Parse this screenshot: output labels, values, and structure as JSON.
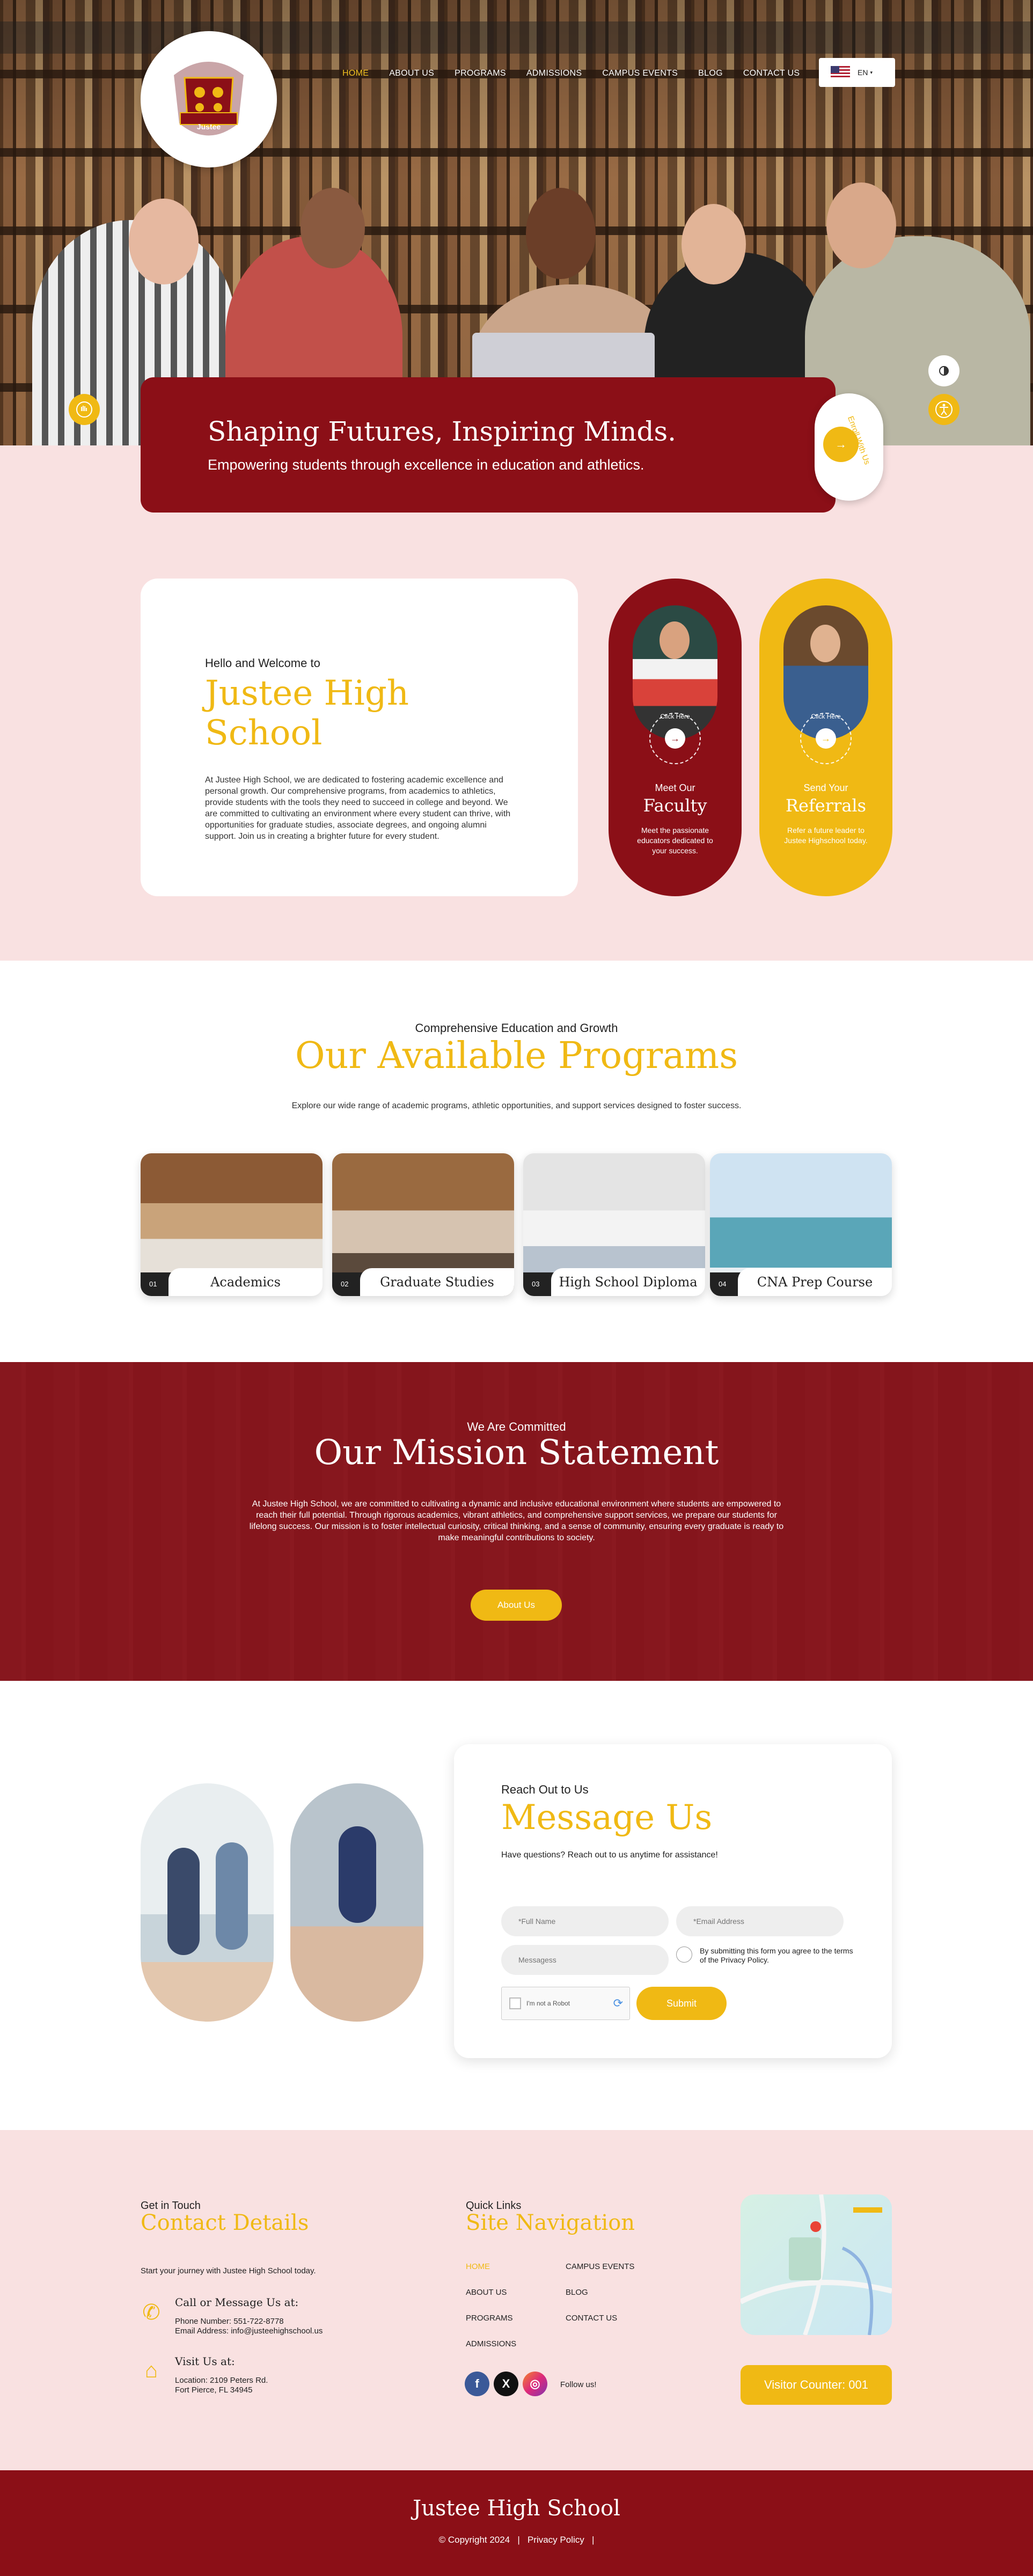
{
  "nav": {
    "items": [
      "HOME",
      "ABOUT US",
      "PROGRAMS",
      "ADMISSIONS",
      "CAMPUS EVENTS",
      "BLOG",
      "CONTACT US"
    ],
    "active_index": 0,
    "language": "EN"
  },
  "logo": {
    "text": "Justee",
    "subtext": "HIGH SCHOOL"
  },
  "hero": {
    "title": "Shaping Futures, Inspiring Minds.",
    "subtitle": "Empowering students through excellence in education and athletics.",
    "enroll_text": "Enroll With Us"
  },
  "welcome": {
    "kicker": "Hello and Welcome to",
    "title": "Justee High School",
    "body": "At Justee High School, we are dedicated to fostering academic excellence and personal growth. Our comprehensive programs, from academics to athletics, provide students with the tools they need to succeed in college and beyond. We are committed to cultivating an environment where every student can thrive, with opportunities for graduate studies, associate degrees, and ongoing alumni support. Join us in creating a brighter future for every student."
  },
  "faculty_pill": {
    "click_text": "Click Here",
    "sub": "Meet Our",
    "title": "Faculty",
    "desc": "Meet the passionate educators dedicated to your success."
  },
  "referral_pill": {
    "click_text": "Click Here",
    "sub": "Send Your",
    "title": "Referrals",
    "desc": "Refer a future leader to Justee Highschool today."
  },
  "programs": {
    "kicker": "Comprehensive Education and Growth",
    "title": "Our Available Programs",
    "intro": "Explore our wide range of academic programs, athletic opportunities, and support services designed to foster success.",
    "items": [
      {
        "num": "01",
        "label": "Academics"
      },
      {
        "num": "02",
        "label": "Graduate Studies"
      },
      {
        "num": "03",
        "label": "High School Diploma"
      },
      {
        "num": "04",
        "label": "CNA Prep Course"
      }
    ]
  },
  "mission": {
    "kicker": "We Are Committed",
    "title": "Our Mission Statement",
    "body": "At Justee High School, we are committed to cultivating a dynamic and inclusive educational environment where students are empowered to reach their full potential. Through rigorous academics, vibrant athletics, and comprehensive support services, we prepare our students for lifelong success. Our mission is to foster intellectual curiosity, critical thinking, and a sense of community, ensuring every graduate is ready to make meaningful contributions to society.",
    "button": "About Us"
  },
  "message": {
    "kicker": "Reach Out to Us",
    "title": "Message Us",
    "intro": "Have questions? Reach out to us anytime for assistance!",
    "full_name_placeholder": "*Full Name",
    "email_placeholder": "*Email Address",
    "message_placeholder": "Messagess",
    "consent_prefix": "By submitting this form you agree to the terms of the ",
    "consent_link": "Privacy Policy.",
    "captcha": "I'm not a Robot",
    "submit": "Submit"
  },
  "footer": {
    "contact_kicker": "Get in Touch",
    "contact_title": "Contact Details",
    "contact_intro": "Start your journey with Justee High School today.",
    "call_title": "Call or Message Us at:",
    "phone": "Phone Number: 551-722-8778",
    "email": "Email Address: info@justeehighschool.us",
    "visit_title": "Visit Us at:",
    "location_line1": "Location: 2109 Peters Rd.",
    "location_line2": "Fort Pierce, FL 34945",
    "links_kicker": "Quick Links",
    "links_title": "Site Navigation",
    "links": [
      "HOME",
      "CAMPUS EVENTS",
      "ABOUT US",
      "BLOG",
      "PROGRAMS",
      "CONTACT US",
      "ADMISSIONS"
    ],
    "follow": "Follow us!",
    "visitor": "Visitor Counter: 001"
  },
  "bottom": {
    "title": "Justee High School",
    "copyright": "© Copyright 2024",
    "privacy": "Privacy Policy"
  },
  "colors": {
    "maroon": "#8b0f17",
    "gold": "#f0b914",
    "pink": "#f9e1e1"
  }
}
